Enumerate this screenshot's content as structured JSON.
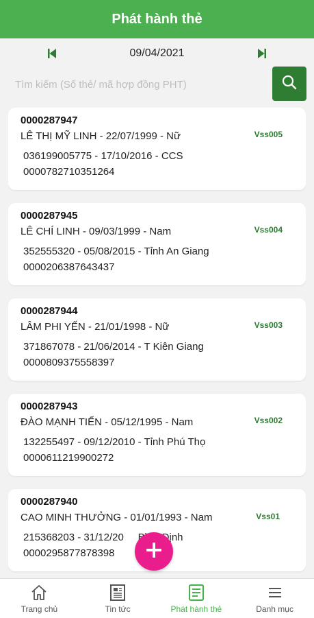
{
  "header": {
    "title": "Phát hành thẻ"
  },
  "date_nav": {
    "date": "09/04/2021",
    "icons": [
      "prev-arrow-icon",
      "next-arrow-icon"
    ]
  },
  "search": {
    "placeholder": "Tìm kiếm (Số thẻ/ mã hợp đồng PHT)",
    "value": "",
    "icon": "search-icon"
  },
  "cards": [
    {
      "id": "0000287947",
      "line1": "LÊ THỊ MỸ LINH - 22/07/1999 - Nữ",
      "line2": "036199005775 - 17/10/2016 - CCS",
      "line3": "0000782710351264",
      "code": "Vss005"
    },
    {
      "id": "0000287945",
      "line1": "LÊ CHÍ LINH - 09/03/1999 - Nam",
      "line2": "352555320 - 05/08/2015 - Tỉnh An Giang",
      "line3": "0000206387643437",
      "code": "Vss004"
    },
    {
      "id": "0000287944",
      "line1": "LÂM PHI YẾN - 21/01/1998 - Nữ",
      "line2": "371867078 - 21/06/2014 - T Kiên Giang",
      "line3": "0000809375558397",
      "code": "Vss003"
    },
    {
      "id": "0000287943",
      "line1": "ĐÀO MẠNH TIẾN - 05/12/1995 - Nam",
      "line2": "132255497 - 09/12/2010 - Tỉnh Phú Thọ",
      "line3": "0000611219900272",
      "code": "Vss002"
    },
    {
      "id": "0000287940",
      "line1": "CAO MINH THƯỞNG - 01/01/1993 - Nam",
      "line2": "215368203 - 31/12/20     Bình Định",
      "line3": "0000295877878398",
      "code": "Vss01"
    }
  ],
  "fab": {
    "icon": "plus-icon"
  },
  "bottom_nav": [
    {
      "label": "Trang chủ",
      "icon": "home-icon"
    },
    {
      "label": "Tin tức",
      "icon": "news-icon"
    },
    {
      "label": "Phát hành thẻ",
      "icon": "card-list-icon",
      "active": true
    },
    {
      "label": "Danh mục",
      "icon": "menu-icon"
    }
  ],
  "colors": {
    "primary": "#4caf50",
    "dark_green": "#2e7d32",
    "fab": "#e91e8c",
    "background": "#f2f2f2"
  }
}
